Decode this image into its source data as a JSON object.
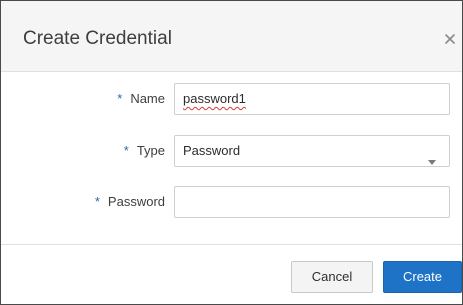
{
  "dialog": {
    "title": "Create Credential",
    "close_icon": "close-icon"
  },
  "form": {
    "required_marker": "*",
    "name": {
      "label": "Name",
      "value": "password1"
    },
    "type": {
      "label": "Type",
      "selected": "Password",
      "dropdown_icon": "chevron-down-icon"
    },
    "password": {
      "label": "Password",
      "value": ""
    }
  },
  "footer": {
    "cancel_label": "Cancel",
    "create_label": "Create"
  },
  "colors": {
    "primary": "#1f73c7",
    "required": "#2b6aa9",
    "spellcheck": "#d23b3b"
  }
}
